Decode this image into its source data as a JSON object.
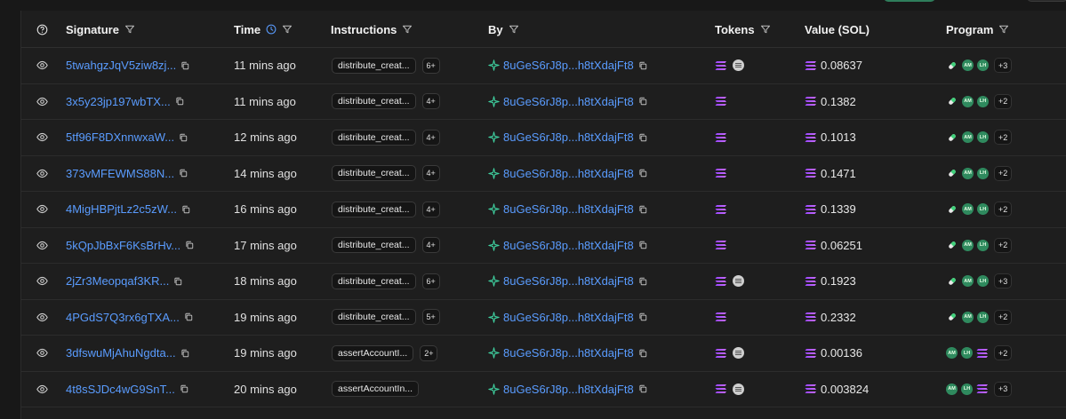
{
  "columns": {
    "signature": "Signature",
    "time": "Time",
    "instructions": "Instructions",
    "by": "By",
    "tokens": "Tokens",
    "value": "Value (SOL)",
    "program": "Program"
  },
  "colors": {
    "link": "#5a9cff",
    "badge_green": "#2f8a5e",
    "solana_purple": "#9945ff",
    "solana_green": "#14f195"
  },
  "rows": [
    {
      "signature": "5twahgzJqV5ziw8zj...",
      "time": "11 mins ago",
      "instruction": "distribute_creat...",
      "instr_count": "6+",
      "by": "8uGeS6rJ8p...h8tXdajFt8",
      "tokens": [
        "sol",
        "usdc"
      ],
      "value": "0.08637",
      "program": [
        "pill",
        "am",
        "lh"
      ],
      "program_more": "+3"
    },
    {
      "signature": "3x5y23jp197wbTX...",
      "time": "11 mins ago",
      "instruction": "distribute_creat...",
      "instr_count": "4+",
      "by": "8uGeS6rJ8p...h8tXdajFt8",
      "tokens": [
        "sol"
      ],
      "value": "0.1382",
      "program": [
        "pill",
        "am",
        "lh"
      ],
      "program_more": "+2"
    },
    {
      "signature": "5tf96F8DXnnwxaW...",
      "time": "12 mins ago",
      "instruction": "distribute_creat...",
      "instr_count": "4+",
      "by": "8uGeS6rJ8p...h8tXdajFt8",
      "tokens": [
        "sol"
      ],
      "value": "0.1013",
      "program": [
        "pill",
        "am",
        "lh"
      ],
      "program_more": "+2"
    },
    {
      "signature": "373vMFEWMS88N...",
      "time": "14 mins ago",
      "instruction": "distribute_creat...",
      "instr_count": "4+",
      "by": "8uGeS6rJ8p...h8tXdajFt8",
      "tokens": [
        "sol"
      ],
      "value": "0.1471",
      "program": [
        "pill",
        "am",
        "lh"
      ],
      "program_more": "+2"
    },
    {
      "signature": "4MigHBPjtLz2c5zW...",
      "time": "16 mins ago",
      "instruction": "distribute_creat...",
      "instr_count": "4+",
      "by": "8uGeS6rJ8p...h8tXdajFt8",
      "tokens": [
        "sol"
      ],
      "value": "0.1339",
      "program": [
        "pill",
        "am",
        "lh"
      ],
      "program_more": "+2"
    },
    {
      "signature": "5kQpJbBxF6KsBrHv...",
      "time": "17 mins ago",
      "instruction": "distribute_creat...",
      "instr_count": "4+",
      "by": "8uGeS6rJ8p...h8tXdajFt8",
      "tokens": [
        "sol"
      ],
      "value": "0.06251",
      "program": [
        "pill",
        "am",
        "lh"
      ],
      "program_more": "+2"
    },
    {
      "signature": "2jZr3Meopqaf3KR...",
      "time": "18 mins ago",
      "instruction": "distribute_creat...",
      "instr_count": "6+",
      "by": "8uGeS6rJ8p...h8tXdajFt8",
      "tokens": [
        "sol",
        "usdc"
      ],
      "value": "0.1923",
      "program": [
        "pill",
        "am",
        "lh"
      ],
      "program_more": "+3"
    },
    {
      "signature": "4PGdS7Q3rx6gTXA...",
      "time": "19 mins ago",
      "instruction": "distribute_creat...",
      "instr_count": "5+",
      "by": "8uGeS6rJ8p...h8tXdajFt8",
      "tokens": [
        "sol"
      ],
      "value": "0.2332",
      "program": [
        "pill",
        "am",
        "lh"
      ],
      "program_more": "+2"
    },
    {
      "signature": "3dfswuMjAhuNgdta...",
      "time": "19 mins ago",
      "instruction": "assertAccountI...",
      "instr_count": "2+",
      "by": "8uGeS6rJ8p...h8tXdajFt8",
      "tokens": [
        "sol",
        "usdc"
      ],
      "value": "0.00136",
      "program": [
        "am",
        "lh",
        "sol"
      ],
      "program_more": "+2"
    },
    {
      "signature": "4t8sSJDc4wG9SnT...",
      "time": "20 mins ago",
      "instruction": "assertAccountIn...",
      "instr_count": "",
      "by": "8uGeS6rJ8p...h8tXdajFt8",
      "tokens": [
        "sol",
        "usdc"
      ],
      "value": "0.003824",
      "program": [
        "am",
        "lh",
        "sol"
      ],
      "program_more": "+3"
    }
  ],
  "badge_labels": {
    "am": "AM",
    "lh": "LH"
  }
}
